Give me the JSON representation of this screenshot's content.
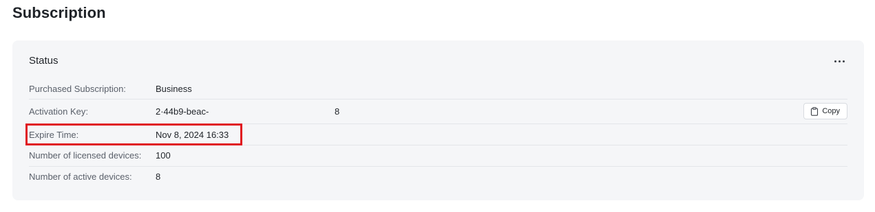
{
  "page": {
    "title": "Subscription"
  },
  "status_card": {
    "title": "Status",
    "more_icon": "more-horizontal-icon",
    "rows": [
      {
        "label": "Purchased Subscription:",
        "value": "Business"
      },
      {
        "label": "Activation Key:",
        "value": "2·44b9-beac-",
        "value_tail": "8",
        "action_label": "Copy",
        "action_icon": "clipboard-icon"
      },
      {
        "label": "Expire Time:",
        "value": "Nov 8, 2024 16:33"
      },
      {
        "label": "Number of licensed devices:",
        "value": "100"
      },
      {
        "label": "Number of active devices:",
        "value": "8"
      }
    ]
  },
  "colors": {
    "card_background": "#f5f6f8",
    "highlight_border": "#e0141e",
    "divider": "#e3e5e9"
  }
}
